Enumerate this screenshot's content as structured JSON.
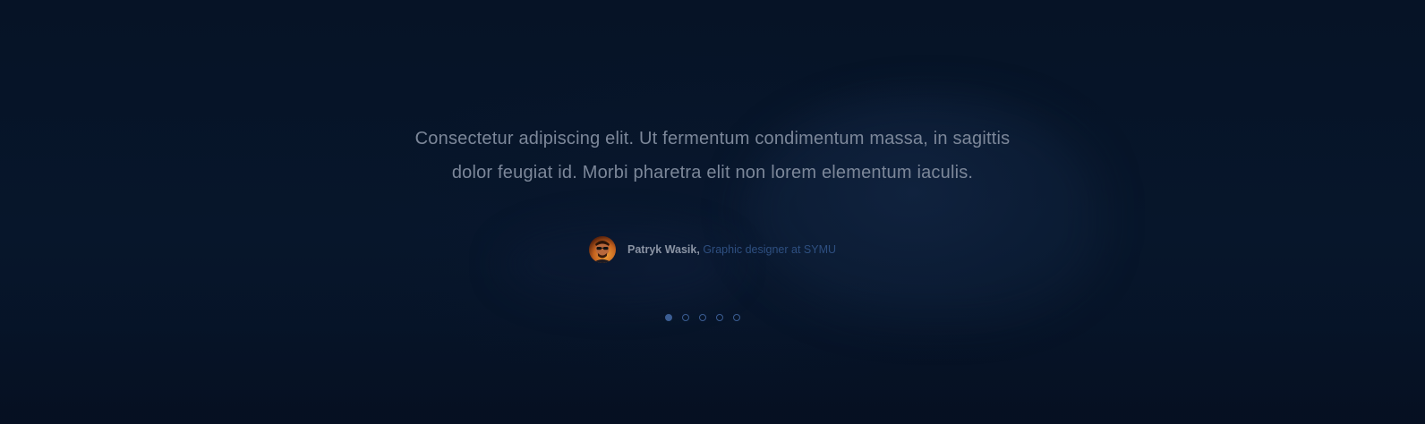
{
  "testimonial": {
    "quote_line1": "Consectetur adipiscing elit. Ut fermentum condimentum massa, in sagittis",
    "quote_line2": "dolor feugiat id. Morbi pharetra elit non lorem elementum iaculis.",
    "author_name": "Patryk Wasik,",
    "author_role": "Graphic designer at SYMU"
  },
  "carousel": {
    "slide_count": 5,
    "active_index": 0
  },
  "colors": {
    "background": "#061226",
    "quote_text": "#7c8799",
    "author_name": "#8a93a3",
    "author_role": "#2e4f80",
    "dot_accent": "#3b5d93"
  },
  "icons": {
    "avatar": "person-with-sunglasses-avatar"
  }
}
